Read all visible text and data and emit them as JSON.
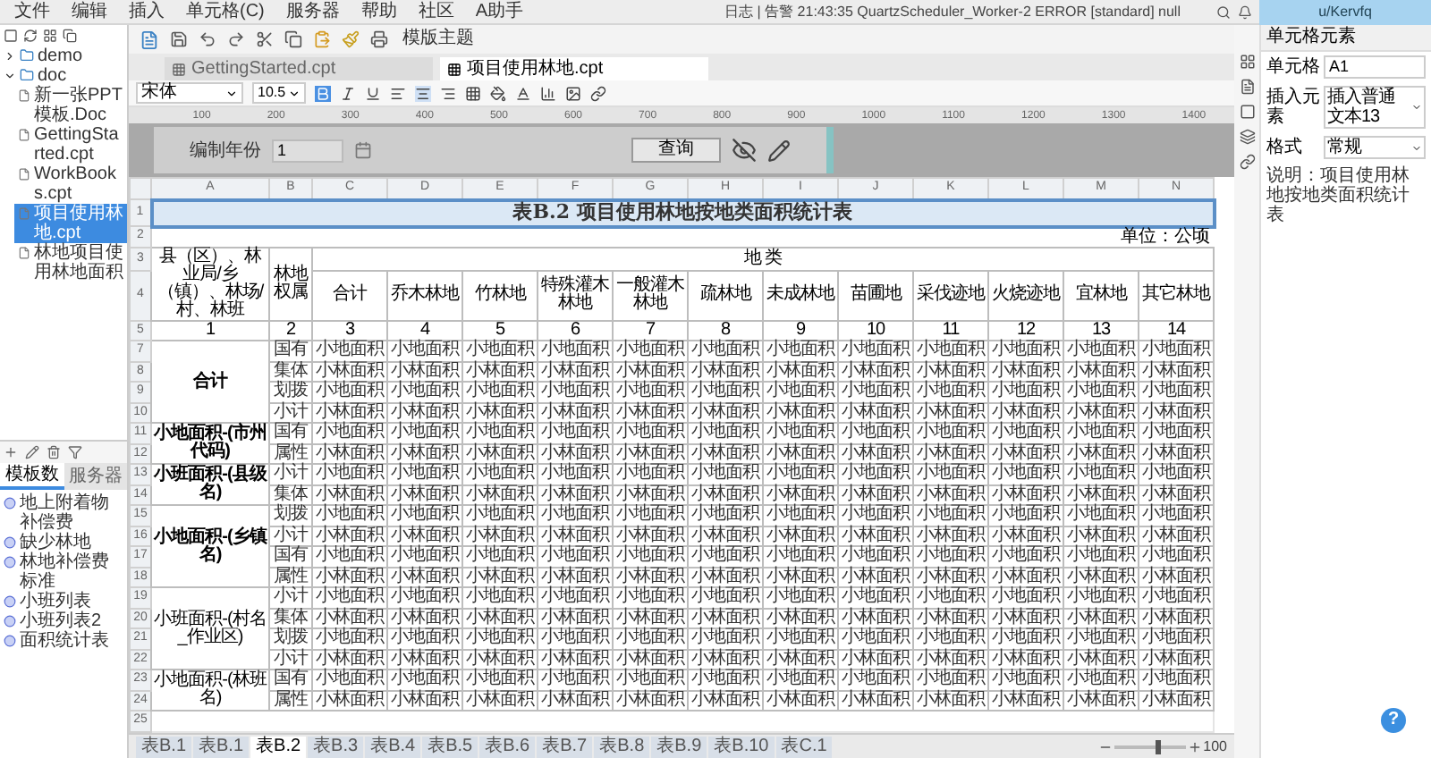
{
  "menu": [
    "文件",
    "编辑",
    "插入",
    "单元格(C)",
    "服务器",
    "帮助",
    "社区",
    "A助手"
  ],
  "status": "日志 | 告警 21:43:35 QuartzScheduler_Worker-2 ERROR [standard] null",
  "user": "u/Kervfq",
  "file_tree": [
    {
      "label": "demo",
      "expanded": false,
      "selected": false
    },
    {
      "label": "doc",
      "expanded": true,
      "selected": false,
      "children": [
        {
          "label": "新一张PPT模板.Doc",
          "selected": false
        },
        {
          "label": "GettingStarted.cpt",
          "selected": false
        },
        {
          "label": "WorkBooks.cpt",
          "selected": false
        },
        {
          "label": "项目使用林地.cpt",
          "selected": true
        },
        {
          "label": "林地项目使用林地面积",
          "selected": false
        }
      ]
    }
  ],
  "template_panel": {
    "tabs": [
      {
        "label": "模板数",
        "selected": true
      },
      {
        "label": "服务器",
        "selected": false
      }
    ],
    "items": [
      "地上附着物补偿费",
      "缺少林地",
      "林地补偿费标准",
      "小班列表",
      "小班列表2",
      "面积统计表"
    ]
  },
  "toolbar": {
    "theme_button": "模版主题"
  },
  "editor_tabs": [
    {
      "label": "GettingStarted.cpt",
      "selected": false
    },
    {
      "label": "项目使用林地.cpt",
      "selected": true
    }
  ],
  "format_bar": {
    "font": "宋体",
    "size": "10.5"
  },
  "ruler": [
    "100",
    "200",
    "300",
    "400",
    "500",
    "600",
    "700",
    "800",
    "900",
    "1000",
    "1100",
    "1200",
    "1300",
    "1400"
  ],
  "parameters": {
    "label": "编制年份",
    "value": "1",
    "query_button": "查询"
  },
  "sheet": {
    "columns": [
      "A",
      "B",
      "C",
      "D",
      "E",
      "F",
      "G",
      "H",
      "I",
      "J",
      "K",
      "L",
      "M",
      "N"
    ],
    "header_row_numbers": [
      "1",
      "2",
      "3",
      "4",
      "5"
    ],
    "title": "表B.2 项目使用林地按地类面积统计表",
    "unit": "单位：公顷",
    "area_header": "县（区）、林业局/乡（镇）、林场/村、林班",
    "ownership_header": "林地权属",
    "land_type_header": "地 类",
    "land_types": [
      "合计",
      "乔木林地",
      "竹林地",
      "特殊灌木林地",
      "一般灌木林地",
      "疏林地",
      "未成林地",
      "苗圃地",
      "采伐迹地",
      "火烧迹地",
      "宜林地",
      "其它林地"
    ],
    "column_numbers": [
      "1",
      "2",
      "3",
      "4",
      "5",
      "6",
      "7",
      "8",
      "9",
      "10",
      "11",
      "12",
      "13",
      "14"
    ],
    "groups": [
      {
        "label": "合计",
        "bold": true,
        "rows": [
          {
            "num": "7",
            "ownership": "国有",
            "cells": [
              "小地面积",
              "小地面积",
              "小地面积",
              "小地面积",
              "小地面积",
              "小地面积",
              "小地面积",
              "小地面积",
              "小地面积",
              "小地面积",
              "小地面积",
              "小地面积"
            ]
          },
          {
            "num": "8",
            "ownership": "集体",
            "cells": [
              "小林面积",
              "小林面积",
              "小林面积",
              "小林面积",
              "小林面积",
              "小林面积",
              "小林面积",
              "小林面积",
              "小林面积",
              "小林面积",
              "小林面积",
              "小林面积"
            ]
          },
          {
            "num": "9",
            "ownership": "划拨",
            "cells": [
              "小地面积",
              "小地面积",
              "小地面积",
              "小地面积",
              "小地面积",
              "小地面积",
              "小地面积",
              "小地面积",
              "小地面积",
              "小地面积",
              "小地面积",
              "小地面积"
            ]
          },
          {
            "num": "10",
            "ownership": "小计",
            "cells": [
              "小林面积",
              "小林面积",
              "小林面积",
              "小林面积",
              "小林面积",
              "小林面积",
              "小林面积",
              "小林面积",
              "小林面积",
              "小林面积",
              "小林面积",
              "小林面积"
            ]
          }
        ]
      },
      {
        "label": "小地面积-(市州代码)",
        "bold": true,
        "rows": [
          {
            "num": "11",
            "ownership": "国有",
            "cells": [
              "小地面积",
              "小地面积",
              "小地面积",
              "小地面积",
              "小地面积",
              "小地面积",
              "小地面积",
              "小地面积",
              "小地面积",
              "小地面积",
              "小地面积",
              "小地面积"
            ]
          },
          {
            "num": "12",
            "ownership": "属性",
            "cells": [
              "小林面积",
              "小林面积",
              "小林面积",
              "小林面积",
              "小林面积",
              "小林面积",
              "小林面积",
              "小林面积",
              "小林面积",
              "小林面积",
              "小林面积",
              "小林面积"
            ]
          }
        ]
      },
      {
        "label": "小班面积-(县级名)",
        "bold": true,
        "rows": [
          {
            "num": "13",
            "ownership": "小计",
            "cells": [
              "小地面积",
              "小地面积",
              "小地面积",
              "小地面积",
              "小地面积",
              "小地面积",
              "小地面积",
              "小地面积",
              "小地面积",
              "小地面积",
              "小地面积",
              "小地面积"
            ]
          },
          {
            "num": "14",
            "ownership": "集体",
            "cells": [
              "小林面积",
              "小林面积",
              "小林面积",
              "小林面积",
              "小林面积",
              "小林面积",
              "小林面积",
              "小林面积",
              "小林面积",
              "小林面积",
              "小林面积",
              "小林面积"
            ]
          }
        ]
      },
      {
        "label": "小地面积-(乡镇名)",
        "bold": true,
        "rows": [
          {
            "num": "15",
            "ownership": "划拨",
            "cells": [
              "小地面积",
              "小地面积",
              "小地面积",
              "小地面积",
              "小地面积",
              "小地面积",
              "小地面积",
              "小地面积",
              "小地面积",
              "小地面积",
              "小地面积",
              "小地面积"
            ]
          },
          {
            "num": "16",
            "ownership": "小计",
            "cells": [
              "小林面积",
              "小林面积",
              "小林面积",
              "小林面积",
              "小林面积",
              "小林面积",
              "小林面积",
              "小林面积",
              "小林面积",
              "小林面积",
              "小林面积",
              "小林面积"
            ]
          },
          {
            "num": "17",
            "ownership": "国有",
            "cells": [
              "小地面积",
              "小地面积",
              "小地面积",
              "小地面积",
              "小地面积",
              "小地面积",
              "小地面积",
              "小地面积",
              "小地面积",
              "小地面积",
              "小地面积",
              "小地面积"
            ]
          },
          {
            "num": "18",
            "ownership": "属性",
            "cells": [
              "小林面积",
              "小林面积",
              "小林面积",
              "小林面积",
              "小林面积",
              "小林面积",
              "小林面积",
              "小林面积",
              "小林面积",
              "小林面积",
              "小林面积",
              "小林面积"
            ]
          }
        ]
      },
      {
        "label": "小班面积-(村名_作业区)",
        "bold": false,
        "rows": [
          {
            "num": "19",
            "ownership": "小计",
            "cells": [
              "小地面积",
              "小地面积",
              "小地面积",
              "小地面积",
              "小地面积",
              "小地面积",
              "小地面积",
              "小地面积",
              "小地面积",
              "小地面积",
              "小地面积",
              "小地面积"
            ]
          },
          {
            "num": "20",
            "ownership": "集体",
            "cells": [
              "小林面积",
              "小林面积",
              "小林面积",
              "小林面积",
              "小林面积",
              "小林面积",
              "小林面积",
              "小林面积",
              "小林面积",
              "小林面积",
              "小林面积",
              "小林面积"
            ]
          },
          {
            "num": "21",
            "ownership": "划拨",
            "cells": [
              "小地面积",
              "小地面积",
              "小地面积",
              "小地面积",
              "小地面积",
              "小地面积",
              "小地面积",
              "小地面积",
              "小地面积",
              "小地面积",
              "小地面积",
              "小地面积"
            ]
          },
          {
            "num": "22",
            "ownership": "小计",
            "cells": [
              "小林面积",
              "小林面积",
              "小林面积",
              "小林面积",
              "小林面积",
              "小林面积",
              "小林面积",
              "小林面积",
              "小林面积",
              "小林面积",
              "小林面积",
              "小林面积"
            ]
          }
        ]
      },
      {
        "label": "小地面积-(林班名)",
        "bold": false,
        "rows": [
          {
            "num": "23",
            "ownership": "国有",
            "cells": [
              "小地面积",
              "小地面积",
              "小地面积",
              "小地面积",
              "小地面积",
              "小地面积",
              "小地面积",
              "小地面积",
              "小地面积",
              "小地面积",
              "小地面积",
              "小地面积"
            ]
          },
          {
            "num": "24",
            "ownership": "属性",
            "cells": [
              "小林面积",
              "小林面积",
              "小林面积",
              "小林面积",
              "小林面积",
              "小林面积",
              "小林面积",
              "小林面积",
              "小林面积",
              "小林面积",
              "小林面积",
              "小林面积"
            ]
          }
        ]
      }
    ],
    "empty_rows": [
      "25"
    ]
  },
  "right_panel": {
    "title": "单元格元素",
    "fields": [
      {
        "label": "单元格",
        "value": "A1",
        "kind": "text"
      },
      {
        "label": "插入元素",
        "value": "插入普通文本13",
        "kind": "select"
      },
      {
        "label": "格式",
        "value": "常规",
        "kind": "select"
      }
    ],
    "note": "说明：项目使用林地按地类面积统计表"
  },
  "sheet_tabs": [
    {
      "label": "表B.1",
      "selected": false
    },
    {
      "label": "表B.1",
      "selected": false
    },
    {
      "label": "表B.2",
      "selected": true
    },
    {
      "label": "表B.3",
      "selected": false
    },
    {
      "label": "表B.4",
      "selected": false
    },
    {
      "label": "表B.5",
      "selected": false
    },
    {
      "label": "表B.6",
      "selected": false
    },
    {
      "label": "表B.7",
      "selected": false
    },
    {
      "label": "表B.8",
      "selected": false
    },
    {
      "label": "表B.9",
      "selected": false
    },
    {
      "label": "表B.10",
      "selected": false
    },
    {
      "label": "表C.1",
      "selected": false
    }
  ],
  "zoom_slider": {
    "level": 0.6
  },
  "zoom": "100",
  "help": "?"
}
